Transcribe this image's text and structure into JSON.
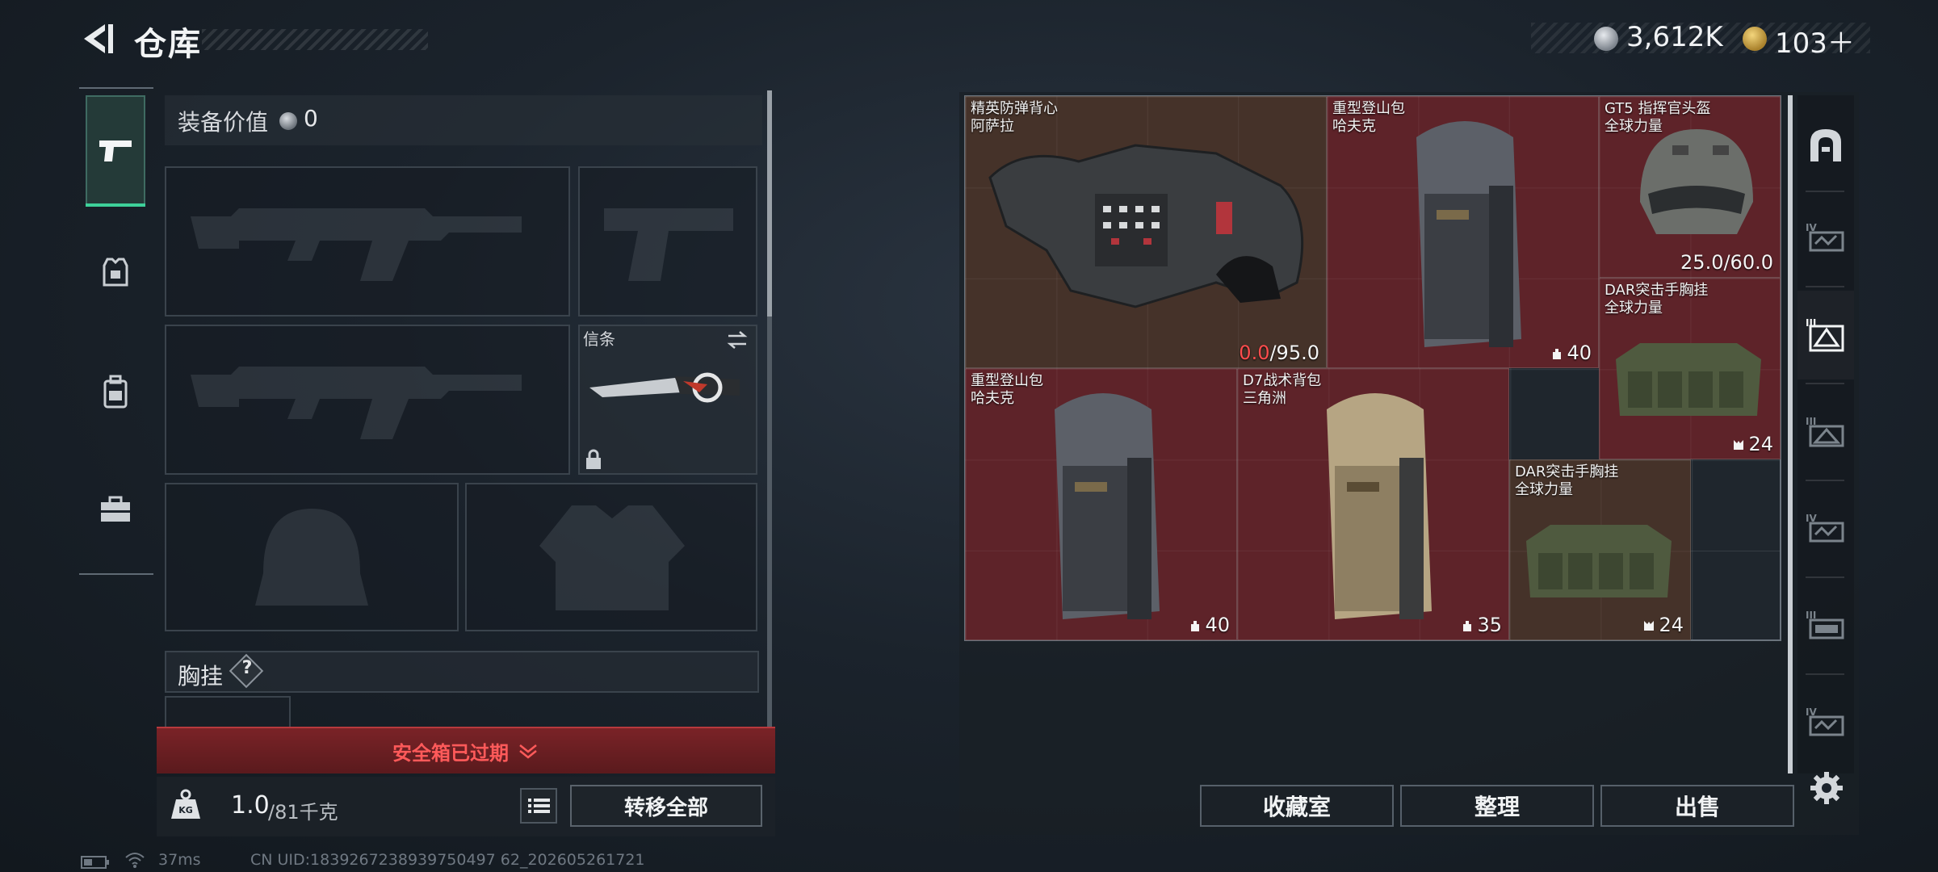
{
  "header": {
    "title": "仓库",
    "coins_value": "3,612K",
    "tokens_value": "103＋",
    "coin_icon": "silver-coin-icon",
    "token_icon": "gold-triangle-token-icon"
  },
  "categories": [
    {
      "name": "weapon",
      "icon": "pistol-icon",
      "selected": true
    },
    {
      "name": "armor",
      "icon": "armor-vest-icon",
      "selected": false
    },
    {
      "name": "backpack",
      "icon": "backpack-icon",
      "selected": false
    },
    {
      "name": "case",
      "icon": "briefcase-icon",
      "selected": false
    }
  ],
  "loadout": {
    "value_label": "装备价值",
    "value_number": "0",
    "melee_label": "信条",
    "rig_label": "胸挂",
    "rig_help": "?",
    "expired_banner": "安全箱已过期",
    "weight_current": "1.0",
    "weight_max": "/81千克",
    "transfer_all": "转移全部"
  },
  "storage": {
    "items": [
      {
        "id": "vest",
        "name_line1": "精英防弹背心",
        "name_line2": "阿萨拉",
        "durability_current": "0.0",
        "durability_max": "/95.0",
        "bg": "brown"
      },
      {
        "id": "bag1",
        "name_line1": "重型登山包",
        "name_line2": "哈夫克",
        "stat": "40",
        "bg": "red"
      },
      {
        "id": "helmet",
        "name_line1": "GT5 指挥官头盔",
        "name_line2": "全球力量",
        "stat": "25.0/60.0",
        "bg": "red"
      },
      {
        "id": "rig1",
        "name_line1": "DAR突击手胸挂",
        "name_line2": "全球力量",
        "stat": "24",
        "bg": "red"
      },
      {
        "id": "bag2",
        "name_line1": "重型登山包",
        "name_line2": "哈夫克",
        "stat": "40",
        "bg": "red"
      },
      {
        "id": "bag3",
        "name_line1": "D7战术背包",
        "name_line2": "三角洲",
        "stat": "35",
        "bg": "red"
      },
      {
        "id": "rig2",
        "name_line1": "DAR突击手胸挂",
        "name_line2": "全球力量",
        "stat": "24",
        "bg": "brown"
      }
    ]
  },
  "right_tabs": [
    {
      "icon": "vault-door-icon"
    },
    {
      "icon": "tier-iv-storage-icon"
    },
    {
      "icon": "tier-iii-storage-icon"
    },
    {
      "icon": "tier-iii-storage-icon"
    },
    {
      "icon": "tier-iv-storage-icon"
    },
    {
      "icon": "tier-iii-storage-icon"
    },
    {
      "icon": "tier-iv-storage-icon"
    }
  ],
  "actions": {
    "collection": "收藏室",
    "organize": "整理",
    "sell": "出售"
  },
  "status": {
    "ping": "37ms",
    "uid": "CN UID:1839267238939750497 62_202605261721"
  },
  "colors": {
    "accent_green": "#3ed19a",
    "danger_red": "#ff4d4d",
    "item_red_bg": "#5e2329",
    "item_brown_bg": "#453229"
  }
}
